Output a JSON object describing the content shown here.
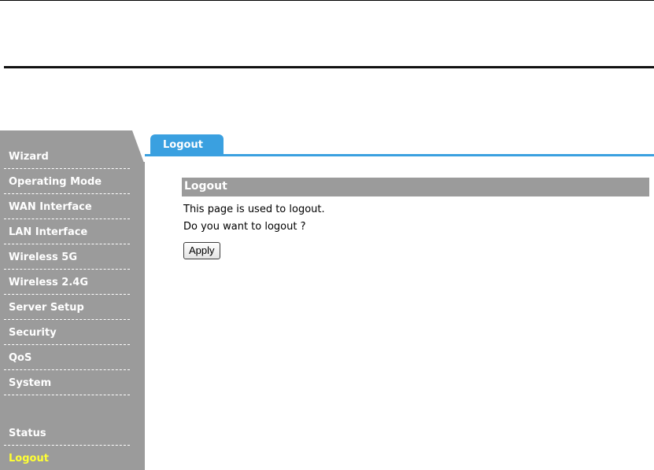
{
  "sidebar": {
    "items": [
      {
        "label": "Wizard"
      },
      {
        "label": "Operating Mode"
      },
      {
        "label": "WAN Interface"
      },
      {
        "label": "LAN Interface"
      },
      {
        "label": "Wireless 5G"
      },
      {
        "label": "Wireless 2.4G"
      },
      {
        "label": "Server Setup"
      },
      {
        "label": "Security"
      },
      {
        "label": "QoS"
      },
      {
        "label": "System"
      },
      {
        "label": "Status"
      },
      {
        "label": "Logout",
        "active": true
      }
    ]
  },
  "tab": {
    "label": "Logout"
  },
  "main": {
    "section_title": "Logout",
    "description": "This page is used to logout.",
    "question": "Do you want to logout ?",
    "apply_label": "Apply"
  },
  "colors": {
    "sidebar_bg": "#9b9b9b",
    "tab_accent": "#3aa0e0",
    "active_item": "#ffff33"
  }
}
